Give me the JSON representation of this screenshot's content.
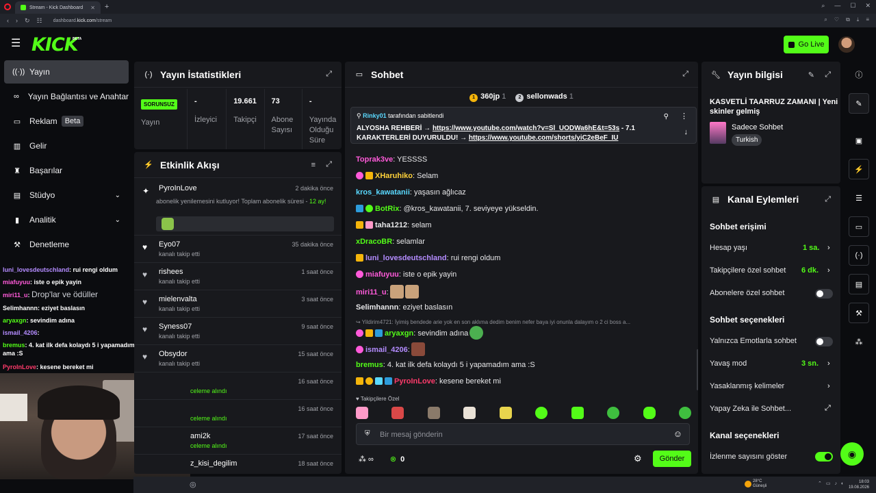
{
  "browser": {
    "tab_title": "Stream - Kick Dashboard",
    "url_prefix": "dashboard.",
    "url_domain": "kick.com",
    "url_path": "/stream"
  },
  "header": {
    "logo": "KICK",
    "logo_badge": "BETA",
    "go_live_label": "Go Live"
  },
  "sidebar": {
    "items": [
      {
        "label": "Yayın",
        "icon": "broadcast-icon"
      },
      {
        "label": "Yayın Bağlantısı ve Anahtar",
        "icon": "link-icon"
      },
      {
        "label": "Reklam",
        "icon": "ad-icon",
        "badge": "Beta"
      },
      {
        "label": "Gelir",
        "icon": "revenue-icon"
      },
      {
        "label": "Başarılar",
        "icon": "trophy-icon"
      },
      {
        "label": "Stüdyo",
        "icon": "studio-icon"
      },
      {
        "label": "Analitik",
        "icon": "analytics-icon"
      },
      {
        "label": "Denetleme",
        "icon": "moderation-icon"
      }
    ]
  },
  "overlay": {
    "lines": [
      {
        "user": "luni_lovesdeutschland",
        "text": ": rui rengi oldum",
        "color": "#b48cff"
      },
      {
        "user": "miafuyuu",
        "text": ": iste o epik yayin",
        "color": "#ff5ad9"
      },
      {
        "user": "miri11_u",
        "text": ": ",
        "color": "#ff5ad9",
        "extra": "Drop'lar ve ödüller"
      },
      {
        "user": "Selimhannn",
        "text": ": eziyet baslasın",
        "color": "#ffffff"
      },
      {
        "user": "aryaxgn",
        "text": ": sevindim adına",
        "color": "#53fc18"
      },
      {
        "user": "ismail_4206",
        "text": ":",
        "color": "#b48cff"
      },
      {
        "user": "bremus",
        "text": ": 4. kat ilk defa kolaydı 5 i yapamadım ama :S",
        "color": "#53fc18"
      },
      {
        "user": "PyroInLove",
        "text": ": kesene bereket mi",
        "color": "#ff3b6b"
      }
    ]
  },
  "stats": {
    "title": "Yayın İstatistikleri",
    "status_badge": "SORUNSUZ",
    "status_label": "Yayın",
    "items": [
      {
        "value": "-",
        "label": "İzleyici"
      },
      {
        "value": "19.661",
        "label": "Takipçi"
      },
      {
        "value": "73",
        "label": "Abone Sayısı"
      },
      {
        "value": "-",
        "label": "Yayında Olduğu Süre"
      }
    ]
  },
  "activity": {
    "title": "Etkinlik Akışı",
    "first": {
      "name": "PyroInLove",
      "time": "2 dakika önce",
      "text": "abonelik yenilemesini kutluyor! Toplam abonelik süresi - ",
      "months": "12 ay!"
    },
    "items": [
      {
        "name": "Eyo07",
        "action": "kanalı takip etti",
        "time": "35 dakika önce"
      },
      {
        "name": "rishees",
        "action": "kanalı takip etti",
        "time": "1 saat önce"
      },
      {
        "name": "mielenvalta",
        "action": "kanalı takip etti",
        "time": "3 saat önce"
      },
      {
        "name": "Syness07",
        "action": "kanalı takip etti",
        "time": "9 saat önce"
      },
      {
        "name": "Obsydor",
        "action": "kanalı takip etti",
        "time": "15 saat önce"
      },
      {
        "name": "",
        "action": "celeme alındı",
        "time": "16 saat önce"
      },
      {
        "name": "",
        "action": "celeme alındı",
        "time": "16 saat önce"
      },
      {
        "name": "ami2k",
        "action": "celeme alındı",
        "time": "17 saat önce"
      },
      {
        "name": "z_kisi_degilim",
        "action": "",
        "time": "18 saat önce"
      }
    ]
  },
  "chat": {
    "title": "Sohbet",
    "top1_user": "360jp",
    "top1_count": "1",
    "top2_user": "sellonwads",
    "top2_count": "1",
    "pinned_by_user": "Rinky01",
    "pinned_by_suffix": "tarafından sabitlendi",
    "pinned_text_1": "ALYOSHA REHBERİ → ",
    "pinned_link_1": "https://www.youtube.com/watch?v=Sl_UODWa6hE&t=53s",
    "pinned_text_2": " - 7.1 KARAKTERLERİ DUYURULDU! → ",
    "pinned_link_2": "https://www.youtube.com/shorts/yiC2eBeF_IU",
    "messages": [
      {
        "user": "Toprak3ve",
        "text": ": YESSSS",
        "color": "#ff5ad9"
      },
      {
        "user": "XHaruhiko",
        "text": ": Selam",
        "color": "#ffd23a"
      },
      {
        "user": "kros_kawatanii",
        "text": ": yaşasın ağlıcaz",
        "color": "#5ad9ff"
      },
      {
        "user": "BotRix",
        "text": ": @kros_kawatanii, 7. seviyeye yükseldin.",
        "color": "#53fc18"
      },
      {
        "user": "taha1212",
        "text": ": selam",
        "color": "#ffffff"
      },
      {
        "user": "xDracoBR",
        "text": ": selamlar",
        "color": "#53fc18"
      },
      {
        "user": "luni_lovesdeutschland",
        "text": ": rui rengi oldum",
        "color": "#b48cff"
      },
      {
        "user": "miafuyuu",
        "text": ": iste o epik yayin",
        "color": "#ff5ad9"
      },
      {
        "user": "miri11_u",
        "text": ":",
        "color": "#ff5ad9"
      },
      {
        "user": "Selimhannn",
        "text": ": eziyet baslasın",
        "color": "#ffffff"
      },
      {
        "user": "aryaxgn",
        "text": ": sevindim adına",
        "color": "#53fc18"
      },
      {
        "user": "ismail_4206",
        "text": ":",
        "color": "#b48cff"
      },
      {
        "user": "bremus",
        "text": ": 4. kat ilk defa kolaydı 5 i yapamadım ama :S",
        "color": "#53fc18"
      },
      {
        "user": "PyroInLove",
        "text": ": kesene bereket mi",
        "color": "#ff3b6b"
      }
    ],
    "reply_preview": "Yildirim4721: İyimiş bendede arie yok en son aklıma dedim benim nefer baya iyi onunla dalayım o 2 ci boss a...",
    "emote_label": "Takipçilere Özel",
    "input_placeholder": "Bir mesaj gönderin",
    "points_value": "0",
    "send_label": "Gönder"
  },
  "info": {
    "title": "Yayın bilgisi",
    "stream_title": "KASVETLİ TAARRUZ ZAMANI | Yeni skinler gelmiş",
    "category": "Sadece Sohbet",
    "tag": "Turkish"
  },
  "channel": {
    "title": "Kanal Eylemleri",
    "section1": "Sohbet erişimi",
    "account_age": "Hesap yaşı",
    "account_age_value": "1 sa.",
    "followers_chat": "Takipçilere özel sohbet",
    "followers_chat_value": "6 dk.",
    "subs_chat": "Abonelere özel sohbet",
    "section2": "Sohbet seçenekleri",
    "emote_only": "Yalnızca Emotlarla sohbet",
    "slow_mode": "Yavaş mod",
    "slow_mode_value": "3 sn.",
    "banned_words": "Yasaklanmış kelimeler",
    "ai_chat": "Yapay Zeka ile Sohbet...",
    "section3": "Kanal seçenekleri",
    "show_views": "İzlenme sayısını göster"
  },
  "taskbar": {
    "temp": "28°C",
    "weather": "Güneşli",
    "time": "18:03",
    "date": "19.08.2026"
  }
}
